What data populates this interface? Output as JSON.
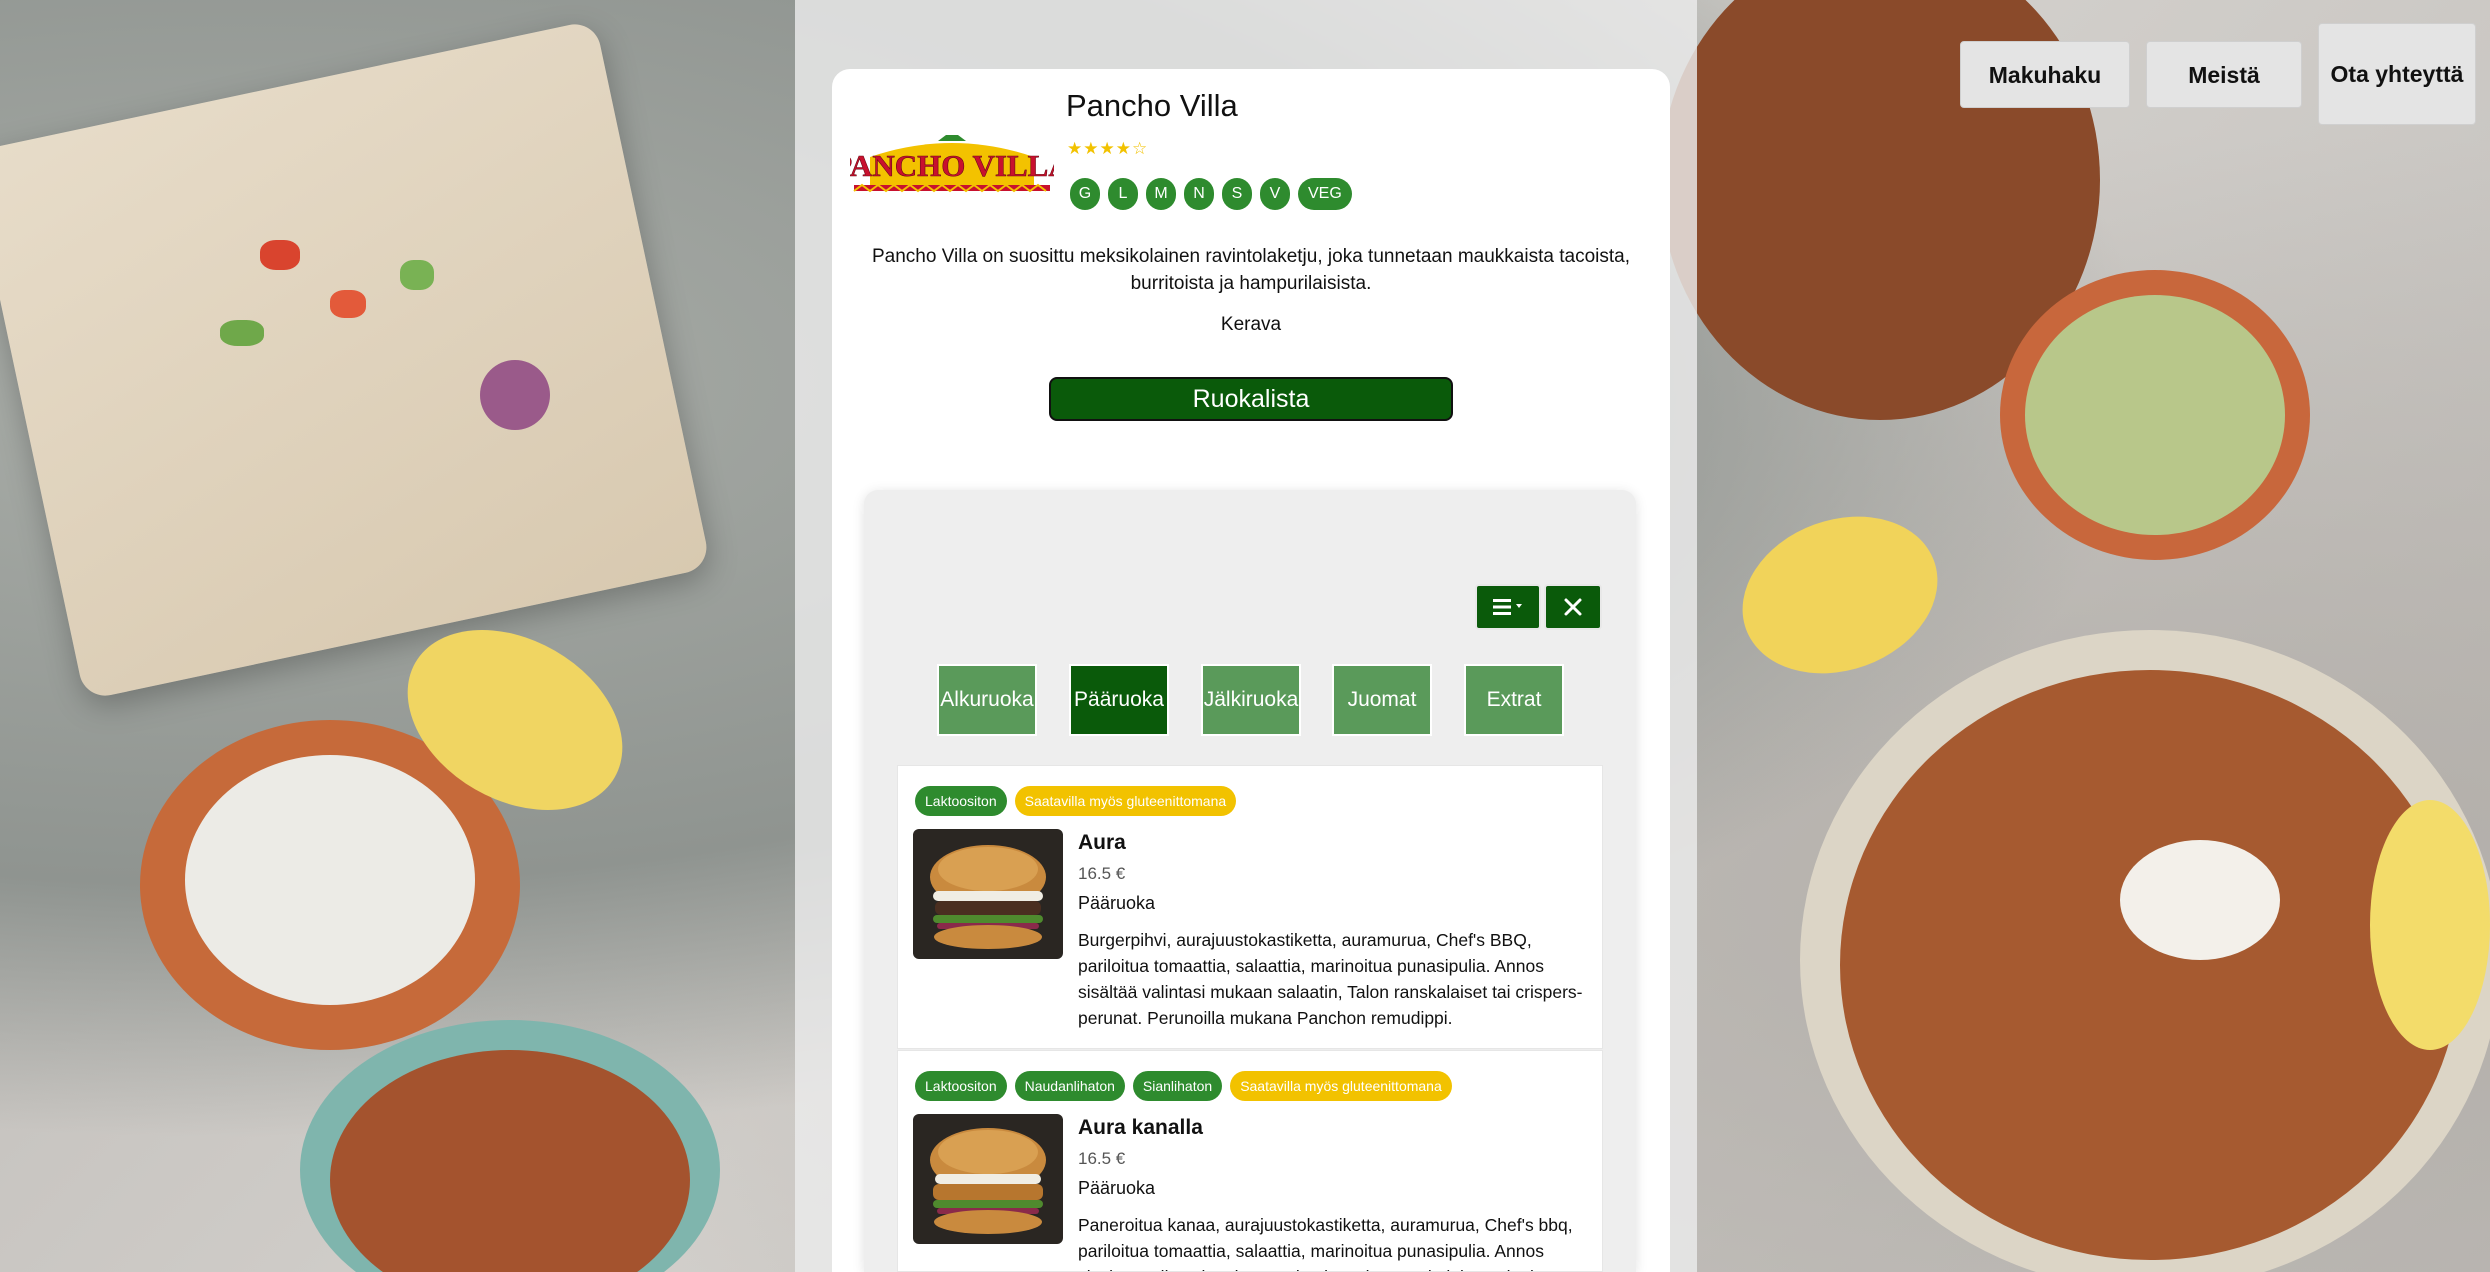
{
  "nav": {
    "items": [
      {
        "label": "Makuhaku"
      },
      {
        "label": "Meistä"
      },
      {
        "label": "Ota yhteyttä"
      }
    ]
  },
  "restaurant": {
    "name": "Pancho Villa",
    "logo_text": "PANCHO VILLA",
    "rating_stars": "★★★★☆",
    "rating": 4,
    "diet_badges": [
      "G",
      "L",
      "M",
      "N",
      "S",
      "V",
      "VEG"
    ],
    "description": "Pancho Villa on suosittu meksikolainen ravintolaketju, joka tunnetaan maukkaista tacoista, burritoista ja hampurilaisista.",
    "city": "Kerava",
    "menu_button": "Ruokalista"
  },
  "menu": {
    "list_icon": "list-icon",
    "close_icon": "close-icon",
    "categories": [
      {
        "label": "Alkuruoka",
        "active": false
      },
      {
        "label": "Pääruoka",
        "active": true
      },
      {
        "label": "Jälkiruoka",
        "active": false
      },
      {
        "label": "Juomat",
        "active": false
      },
      {
        "label": "Extrat",
        "active": false
      }
    ],
    "items": [
      {
        "tags": [
          {
            "label": "Laktoositon",
            "color": "#2e8b2e"
          },
          {
            "label": "Saatavilla myös gluteenittomana",
            "color": "#f2c200"
          }
        ],
        "name": "Aura",
        "price": "16.5 €",
        "category": "Pääruoka",
        "description": "Burgerpihvi, aurajuustokastiketta, auramurua, Chef's BBQ, pariloitua tomaattia, salaattia, marinoitua punasipulia. Annos sisältää valintasi mukaan salaatin, Talon ranskalaiset tai crispers-perunat. Perunoilla mukana Panchon remudippi."
      },
      {
        "tags": [
          {
            "label": "Laktoositon",
            "color": "#2e8b2e"
          },
          {
            "label": "Naudanlihaton",
            "color": "#2e8b2e"
          },
          {
            "label": "Sianlihaton",
            "color": "#2e8b2e"
          },
          {
            "label": "Saatavilla myös gluteenittomana",
            "color": "#f2c200"
          }
        ],
        "name": "Aura kanalla",
        "price": "16.5 €",
        "category": "Pääruoka",
        "description": "Paneroitua kanaa, aurajuustokastiketta, auramurua, Chef's bbq, pariloitua tomaattia, salaattia, marinoitua punasipulia. Annos sisältää valintasi mukaan salaatin, Talon ranskalaiset tai crispers-perunat."
      }
    ]
  },
  "colors": {
    "primary_green": "#0a5a0a",
    "tab_green": "#5a9a5a",
    "badge_green": "#2e8b2e",
    "badge_yellow": "#f2c200"
  }
}
